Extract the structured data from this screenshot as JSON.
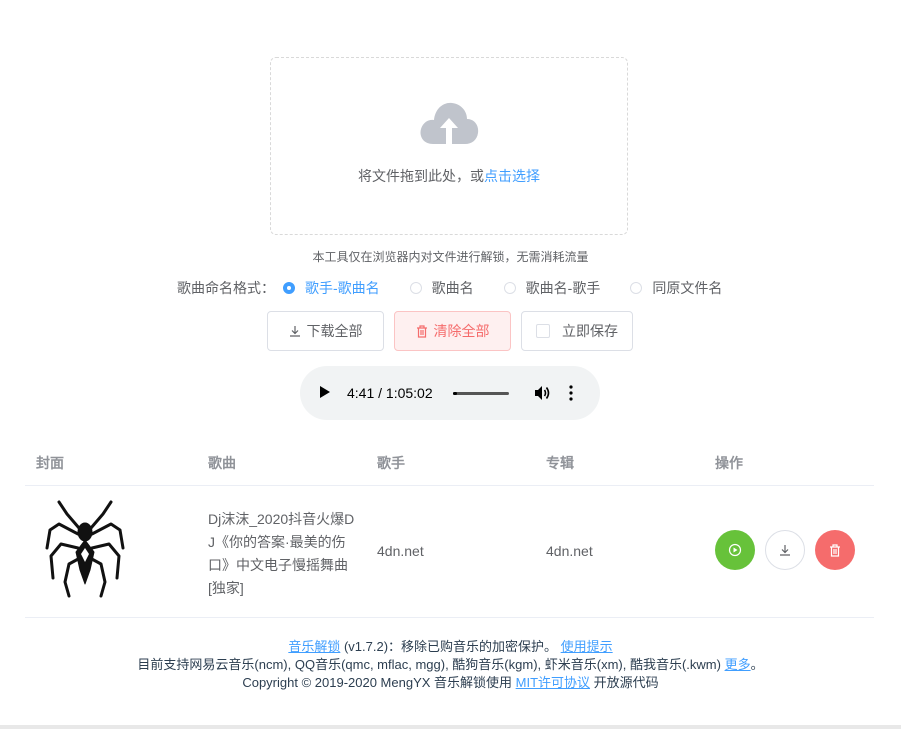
{
  "upload": {
    "text": "将文件拖到此处，或",
    "link": "点击选择",
    "tip": "本工具仅在浏览器内对文件进行解锁，无需消耗流量"
  },
  "format": {
    "label": "歌曲命名格式：",
    "options": [
      {
        "label": "歌手-歌曲名",
        "checked": true
      },
      {
        "label": "歌曲名",
        "checked": false
      },
      {
        "label": "歌曲名-歌手",
        "checked": false
      },
      {
        "label": "同原文件名",
        "checked": false
      }
    ]
  },
  "buttons": {
    "download_all": "下载全部",
    "clear_all": "清除全部",
    "save_now": "立即保存"
  },
  "player": {
    "time": "4:41 / 1:05:02",
    "progress": 0.072
  },
  "table": {
    "headers": {
      "cover": "封面",
      "song": "歌曲",
      "singer": "歌手",
      "album": "专辑",
      "action": "操作"
    },
    "rows": [
      {
        "cover": "spider-emblem",
        "song": "Dj沫沫_2020抖音火爆DJ《你的答案·最美的伤口》中文电子慢摇舞曲[独家]",
        "singer": "4dn.net",
        "album": "4dn.net"
      }
    ]
  },
  "footer": {
    "line1_link": "音乐解锁",
    "line1_text": " (v1.7.2)：移除已购音乐的加密保护。 ",
    "line1_help": "使用提示",
    "line2_text": "目前支持网易云音乐(ncm), QQ音乐(qmc, mflac, mgg), 酷狗音乐(kgm), 虾米音乐(xm), 酷我音乐(.kwm) ",
    "line2_more": "更多",
    "line2_end": "。",
    "line3_text": "Copyright © 2019-2020 MengYX 音乐解锁使用 ",
    "line3_license": "MIT许可协议",
    "line3_end": " 开放源代码"
  },
  "colors": {
    "accent": "#409eff",
    "danger": "#f56c6c",
    "success": "#67c23a"
  },
  "icons": [
    "upload-cloud-icon",
    "download-icon",
    "trash-icon",
    "play-icon",
    "volume-icon",
    "more-vert-icon"
  ]
}
